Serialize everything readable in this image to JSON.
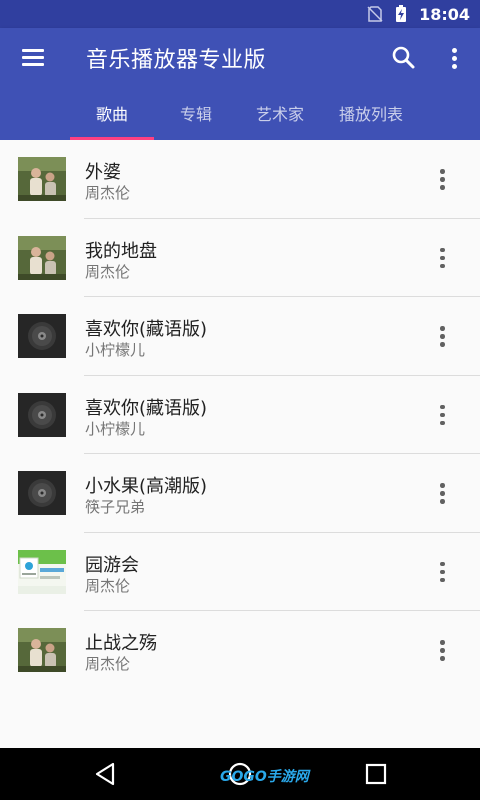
{
  "status_bar": {
    "time": "18:04",
    "icons": [
      "no-sim-icon",
      "battery-charging-icon"
    ]
  },
  "app_bar": {
    "title": "音乐播放器专业版",
    "icons": [
      "menu-icon",
      "search-icon",
      "more-vert-icon"
    ],
    "color": "#3f51b5",
    "status_color": "#303f9f",
    "accent_color": "#ff4081"
  },
  "tabs": [
    {
      "label": "歌曲",
      "active": true
    },
    {
      "label": "专辑",
      "active": false
    },
    {
      "label": "艺术家",
      "active": false
    },
    {
      "label": "播放列表",
      "active": false
    }
  ],
  "songs": [
    {
      "title": "外婆",
      "artist": "周杰伦",
      "art": "photo"
    },
    {
      "title": "我的地盘",
      "artist": "周杰伦",
      "art": "photo"
    },
    {
      "title": "喜欢你(藏语版)",
      "artist": "小柠檬儿",
      "art": "disc"
    },
    {
      "title": "喜欢你(藏语版)",
      "artist": "小柠檬儿",
      "art": "disc"
    },
    {
      "title": "小水果(高潮版)",
      "artist": "筷子兄弟",
      "art": "disc"
    },
    {
      "title": "园游会",
      "artist": "周杰伦",
      "art": "green"
    },
    {
      "title": "止战之殇",
      "artist": "周杰伦",
      "art": "photo"
    }
  ],
  "nav_bar": {
    "icons": [
      "back-icon",
      "home-icon",
      "recent-apps-icon"
    ],
    "watermark": "GOGO手游网",
    "watermark_sub": "WWW.GOGO.CN"
  }
}
